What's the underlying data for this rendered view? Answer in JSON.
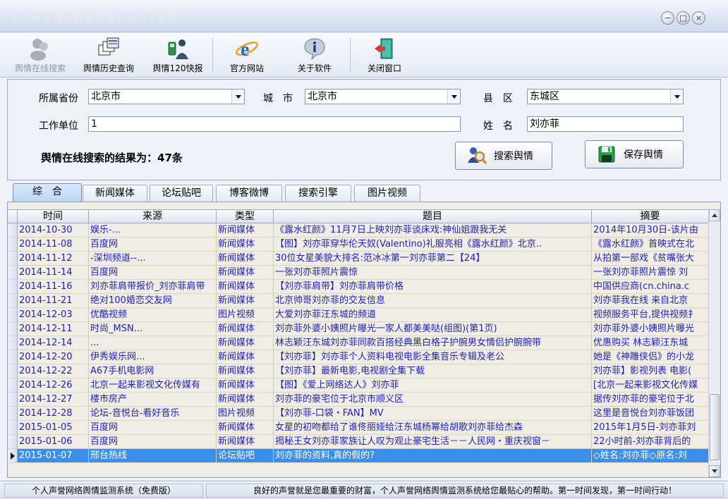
{
  "window": {
    "title": "个人声誉网络舆情监测系统（免费版）",
    "controls": [
      "−",
      "□",
      "×"
    ]
  },
  "toolbar": {
    "items": [
      {
        "label": "舆情在线搜索",
        "icon": "people-icon",
        "enabled": false
      },
      {
        "label": "舆情历史查询",
        "icon": "history-windows-icon",
        "enabled": true
      },
      {
        "label": "舆情120快报",
        "icon": "phone-person-icon",
        "enabled": true
      },
      {
        "label": "官方网站",
        "icon": "ie-browser-icon",
        "enabled": true
      },
      {
        "label": "关于软件",
        "icon": "info-icon",
        "enabled": true
      },
      {
        "label": "关闭窗口",
        "icon": "exit-door-icon",
        "enabled": true
      }
    ]
  },
  "form": {
    "province_label": "所属省份",
    "province_value": "北京市",
    "city_label": "城　市",
    "city_value": "北京市",
    "district_label": "县　区",
    "district_value": "东城区",
    "workunit_label": "工作单位",
    "workunit_value": "1",
    "name_label": "姓　名",
    "name_value": "刘亦菲",
    "result_text": "舆情在线搜索的结果为：47条",
    "search_button": "搜索舆情",
    "save_button": "保存舆情"
  },
  "tabs": [
    "综　合",
    "新闻媒体",
    "论坛贴吧",
    "博客微博",
    "搜索引擎",
    "图片视频"
  ],
  "active_tab": 0,
  "table": {
    "columns": [
      "时间",
      "来源",
      "类型",
      "题目",
      "摘要"
    ],
    "rows": [
      [
        "2014-10-30",
        "娱乐-...",
        "新闻媒体",
        "《露水红颜》11月7日上映刘亦菲谈床戏:神仙姐跟我无关",
        "2014年10月30日-该片由"
      ],
      [
        "2014-11-08",
        "百度网",
        "新闻媒体",
        "【图】刘亦菲穿华伦天奴(Valentino)礼服亮相《露水红颜》北京..",
        "《露水红颜》首映式在北"
      ],
      [
        "2014-11-12",
        "-深圳频道--...",
        "新闻媒体",
        "30位女星美貌大排名:范冰冰第一刘亦菲第二【24】",
        "从拍第一部戏《贫嘴张大"
      ],
      [
        "2014-11-14",
        "百度网",
        "新闻媒体",
        "一张刘亦菲照片震惊",
        "一张刘亦菲照片震惊 刘"
      ],
      [
        "2014-11-16",
        "刘亦菲肩带报价_刘亦菲肩带",
        "新闻媒体",
        "【刘亦菲肩带】刘亦菲肩带价格",
        "中国供应商(cn.china.c"
      ],
      [
        "2014-11-21",
        "绝对100婚恋交友网",
        "新闻媒体",
        "北京帅哥刘亦菲的交友信息",
        "刘亦菲我在线 来自北京"
      ],
      [
        "2014-12-03",
        "优酷视频",
        "图片视频",
        "大爱刘亦菲汪东城的频道",
        "视频服务平台,提供视频扌"
      ],
      [
        "2014-12-11",
        "时尚_MSN...",
        "新闻媒体",
        "刘亦菲外婆小姨照片曝光一家人都美美哒(组图)(第1页)",
        "刘亦菲外婆小姨照片曝光"
      ],
      [
        "2014-12-14",
        "...",
        "新闻媒体",
        "林志颖汪东城刘亦菲同款百搭经典黑白格子护腕男女情侣护腕腕带",
        "优惠购买 林志颖汪东城"
      ],
      [
        "2014-12-20",
        "伊秀娱乐网...",
        "新闻媒体",
        "【刘亦菲】刘亦菲个人资料电视电影全集音乐专辑及老公",
        "她是《神雕侠侣》的小龙"
      ],
      [
        "2014-12-22",
        "A67手机电影网",
        "新闻媒体",
        "【刘亦菲】最新电影,电视剧全集下载",
        "刘亦菲】影视列表 电影("
      ],
      [
        "2014-12-26",
        "北京一起来影视文化传媒有",
        "新闻媒体",
        "【图】《爱上网络达人》刘亦菲",
        "[北京一起来影视文化传媒"
      ],
      [
        "2014-12-27",
        "楼市房产",
        "新闻媒体",
        "刘亦菲的豪宅位于北京市顺义区",
        "据传刘亦菲的豪宅位于北"
      ],
      [
        "2014-12-28",
        "论坛-音悦台-看好音乐",
        "图片视频",
        "【刘亦菲-口袋・FAN】MV",
        "这里是音悦台刘亦菲饭团"
      ],
      [
        "2015-01-05",
        "百度网",
        "新闻媒体",
        "女星的初吻都给了谁佟丽娅给汪东城杨幂给胡歌刘亦菲给杰森",
        "2015年1月5日-刘亦菲刘"
      ],
      [
        "2015-01-06",
        "百度网",
        "新闻媒体",
        "揭秘王女刘亦菲家族让人叹为观止豪宅生活－－人民网・重庆视窗－",
        "22小时前-刘亦菲背后的"
      ],
      [
        "2015-01-07",
        "邢台热线",
        "论坛贴吧",
        "刘亦菲的资料,真的假的?",
        "◇姓名:刘亦菲◇原名:刘"
      ]
    ],
    "selected_row": 16
  },
  "status": {
    "left": "个人声誉网络舆情监测系统（免费版）",
    "right": "良好的声誉就是您最重要的财富，个人声誉网络舆情监测系统给您最贴心的帮助。第一时间发现，第一时间行动！"
  }
}
